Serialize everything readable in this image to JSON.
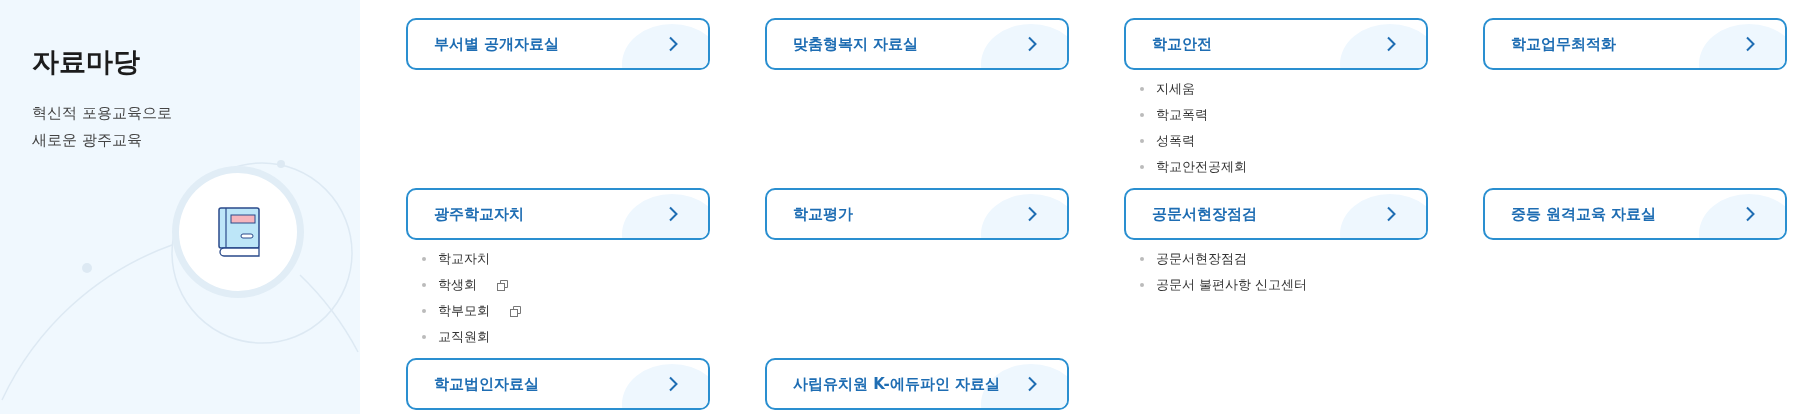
{
  "sidebar": {
    "title": "자료마당",
    "subtitle_lines": [
      "혁신적 포용교육으로",
      "새로운 광주교육"
    ]
  },
  "cards": [
    {
      "label": "부서별 공개자료실"
    },
    {
      "label": "맞춤형복지 자료실"
    },
    {
      "label": "학교안전",
      "links": [
        {
          "label": "지세움",
          "external": false
        },
        {
          "label": "학교폭력",
          "external": false
        },
        {
          "label": "성폭력",
          "external": false
        },
        {
          "label": "학교안전공제회",
          "external": false
        }
      ]
    },
    {
      "label": "학교업무최적화"
    },
    {
      "label": "광주학교자치",
      "links": [
        {
          "label": "학교자치",
          "external": false
        },
        {
          "label": "학생회",
          "external": true
        },
        {
          "label": "학부모회",
          "external": true
        },
        {
          "label": "교직원회",
          "external": false
        }
      ]
    },
    {
      "label": "학교평가"
    },
    {
      "label": "공문서현장점검",
      "links": [
        {
          "label": "공문서현장점검",
          "external": false
        },
        {
          "label": "공문서 불편사항 신고센터",
          "external": false
        }
      ]
    },
    {
      "label": "중등 원격교육 자료실"
    },
    {
      "label": "학교법인자료실"
    },
    {
      "label": "사립유치원 K-에듀파인 자료실"
    }
  ]
}
